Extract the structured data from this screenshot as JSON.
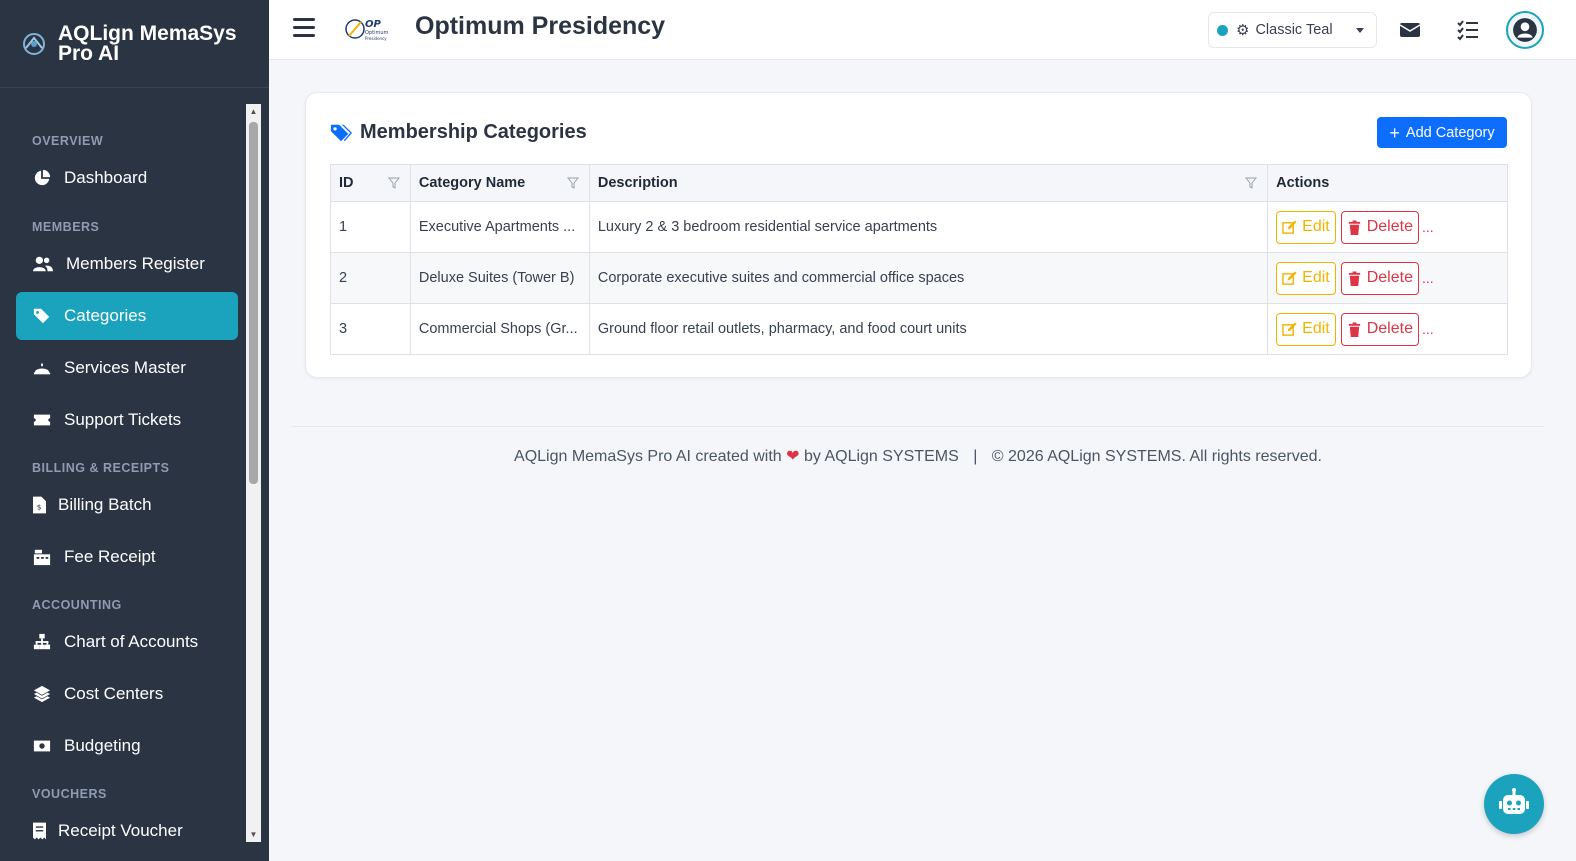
{
  "app": {
    "name": "AQLign MemaSys Pro AI"
  },
  "sidebar": {
    "sections": [
      {
        "label": "OVERVIEW"
      },
      {
        "label": "MEMBERS"
      },
      {
        "label": "BILLING & RECEIPTS"
      },
      {
        "label": "ACCOUNTING"
      },
      {
        "label": "VOUCHERS"
      }
    ],
    "items": [
      {
        "label": "Dashboard",
        "icon": "chart-pie-icon"
      },
      {
        "label": "Members Register",
        "icon": "users-icon"
      },
      {
        "label": "Categories",
        "icon": "tags-icon",
        "active": true
      },
      {
        "label": "Services Master",
        "icon": "bell-concierge-icon"
      },
      {
        "label": "Support Tickets",
        "icon": "ticket-icon"
      },
      {
        "label": "Billing Batch",
        "icon": "file-invoice-icon"
      },
      {
        "label": "Fee Receipt",
        "icon": "cash-register-icon"
      },
      {
        "label": "Chart of Accounts",
        "icon": "sitemap-icon"
      },
      {
        "label": "Cost Centers",
        "icon": "layer-group-icon"
      },
      {
        "label": "Budgeting",
        "icon": "money-bill-icon"
      },
      {
        "label": "Receipt Voucher",
        "icon": "receipt-icon"
      }
    ]
  },
  "header": {
    "title": "Optimum Presidency",
    "logo_text": "OP",
    "logo_subtext": "Optimum Presidency",
    "theme": {
      "selected": "Classic Teal",
      "color": "#1ba3bd"
    }
  },
  "card": {
    "title": "Membership Categories",
    "add_label": "Add Category",
    "columns": [
      "ID",
      "Category Name",
      "Description",
      "Actions"
    ],
    "rows": [
      {
        "id": "1",
        "name": "Executive Apartments ...",
        "description": "Luxury 2 & 3 bedroom residential service apartments"
      },
      {
        "id": "2",
        "name": "Deluxe Suites (Tower B)",
        "description": "Corporate executive suites and commercial office spaces"
      },
      {
        "id": "3",
        "name": "Commercial Shops (Gr...",
        "description": "Ground floor retail outlets, pharmacy, and food court units"
      }
    ],
    "edit_label": "Edit",
    "delete_label": "Delete",
    "more_label": "..."
  },
  "footer": {
    "left_prefix": "AQLign MemaSys Pro AI created with",
    "left_suffix": "by AQLign SYSTEMS",
    "separator": "|",
    "right": "© 2026 AQLign SYSTEMS. All rights reserved."
  },
  "colors": {
    "sidebar_bg": "#2b3443",
    "accent": "#1ba3bd",
    "primary": "#0d6efd",
    "warning": "#f0b400",
    "danger": "#dc3545"
  }
}
